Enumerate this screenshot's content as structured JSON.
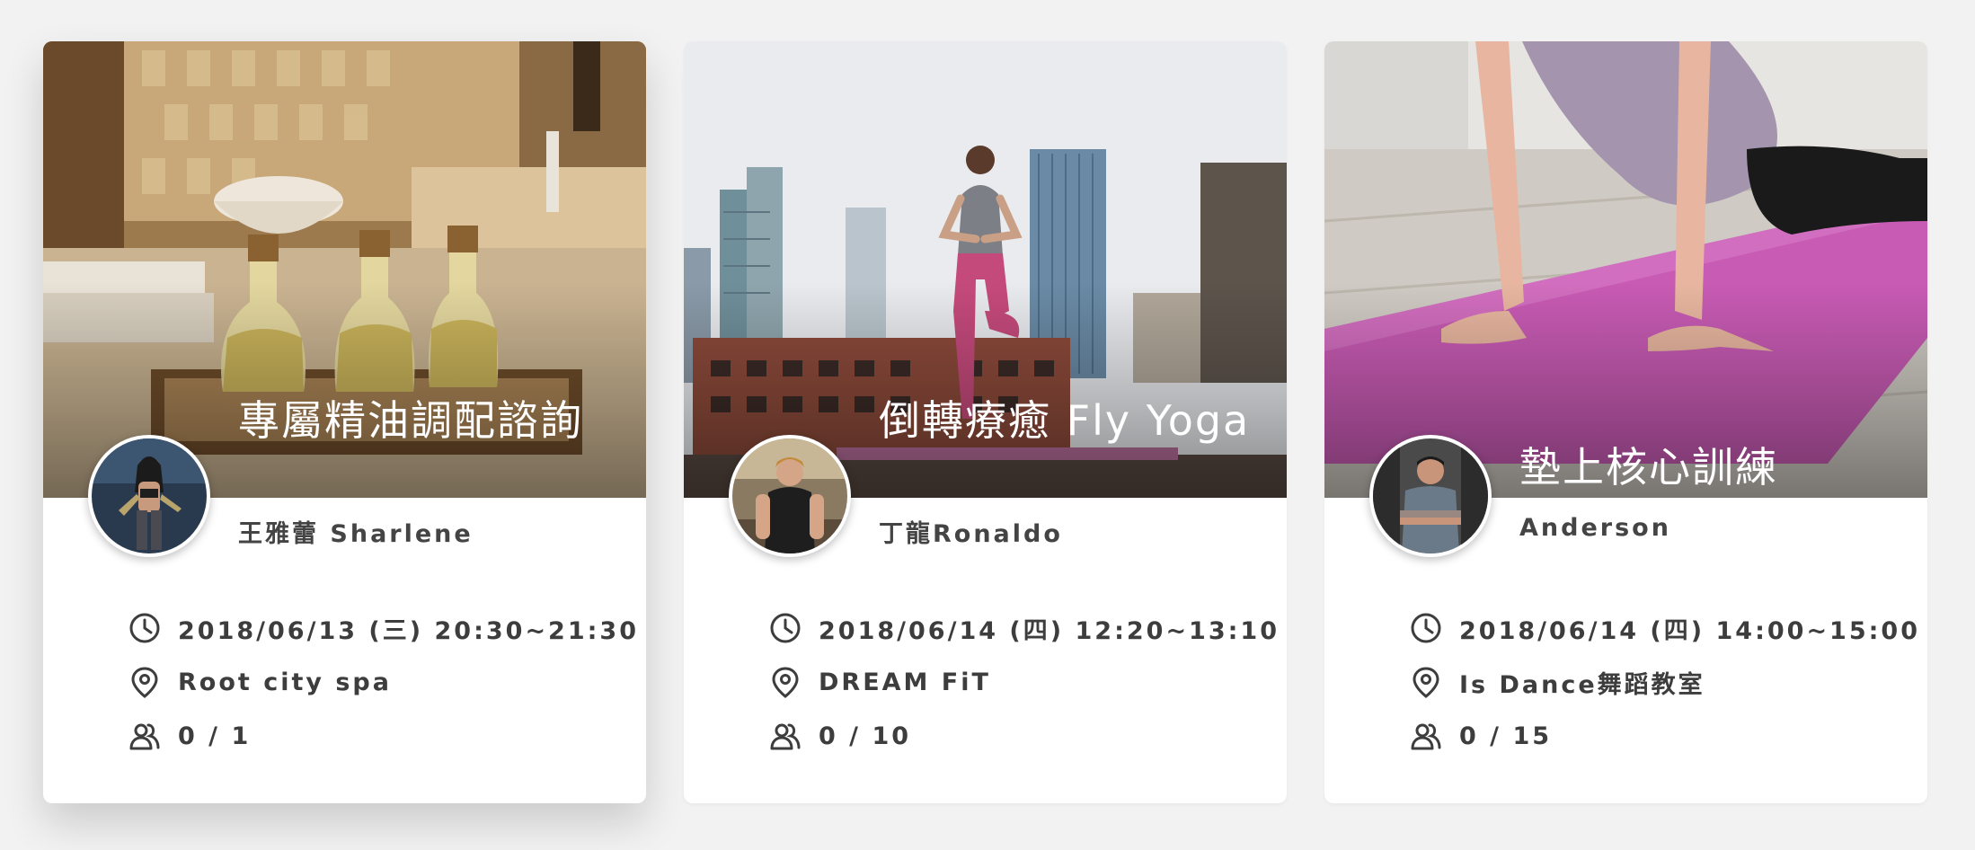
{
  "colors": {
    "page_background": "#f2f2f2",
    "card_background": "#ffffff",
    "text": "#3d3d3d",
    "title_text": "#ffffff"
  },
  "cards": [
    {
      "title": "專屬精油調配諮詢",
      "coach": "王雅蕾 Sharlene",
      "datetime": "2018/06/13 (三) 20:30~21:30",
      "location": "Root city spa",
      "capacity": "0 / 1",
      "image": "essential-oil-bottles-spa-photo"
    },
    {
      "title": "倒轉療癒 Fly Yoga",
      "coach": "丁龍Ronaldo",
      "datetime": "2018/06/14 (四) 12:20~13:10",
      "location": "DREAM FiT",
      "capacity": "0 / 10",
      "image": "rooftop-yoga-city-photo"
    },
    {
      "title": "墊上核心訓練",
      "coach": "Anderson",
      "datetime": "2018/06/14 (四) 14:00~15:00",
      "location": "Is Dance舞蹈教室",
      "capacity": "0 / 15",
      "image": "yoga-mat-plank-photo"
    }
  ],
  "icons": {
    "time": "clock-icon",
    "location": "map-pin-icon",
    "capacity": "users-icon"
  }
}
